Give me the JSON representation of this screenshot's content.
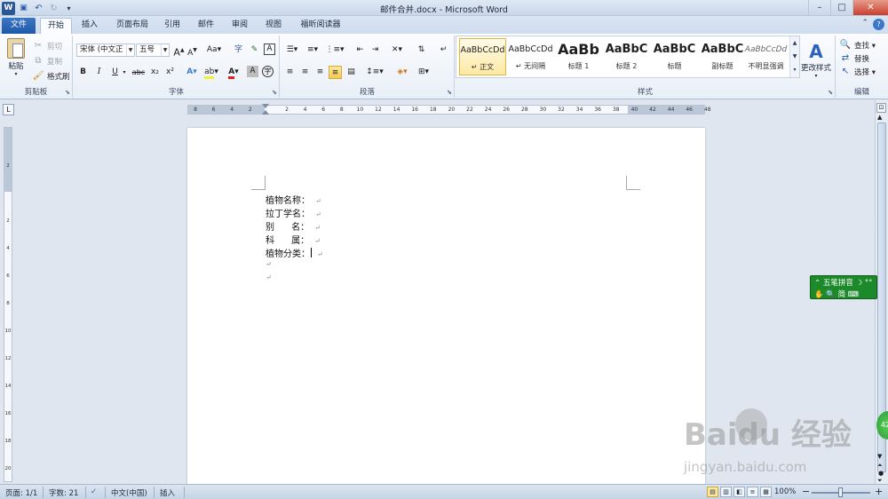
{
  "app": {
    "title": "邮件合并.docx - Microsoft Word",
    "window_buttons": {
      "minimize": "–",
      "maximize": "□",
      "close": "✕"
    },
    "help": "?"
  },
  "quick_access": [
    {
      "icon": "word-logo-icon",
      "glyph": "W"
    },
    {
      "icon": "save-icon",
      "glyph": "💾"
    },
    {
      "icon": "undo-icon",
      "glyph": "↶"
    },
    {
      "icon": "redo-icon",
      "glyph": "↻"
    },
    {
      "icon": "customize-icon",
      "glyph": "▾"
    }
  ],
  "tabs": [
    {
      "label": "文件",
      "name": "tab-file"
    },
    {
      "label": "开始",
      "name": "tab-home",
      "active": true
    },
    {
      "label": "插入",
      "name": "tab-insert"
    },
    {
      "label": "页面布局",
      "name": "tab-page-layout"
    },
    {
      "label": "引用",
      "name": "tab-references"
    },
    {
      "label": "邮件",
      "name": "tab-mailings"
    },
    {
      "label": "审阅",
      "name": "tab-review"
    },
    {
      "label": "视图",
      "name": "tab-view"
    },
    {
      "label": "福昕阅读器",
      "name": "tab-foxit"
    }
  ],
  "ribbon": {
    "clipboard": {
      "label": "剪贴板",
      "paste": "粘贴",
      "cut": "剪切",
      "copy": "复制",
      "format_painter": "格式刷"
    },
    "font": {
      "label": "字体",
      "font_name": "宋体 (中文正",
      "font_size": "五号",
      "grow": "A",
      "shrink": "A",
      "change_case": "Aa",
      "bold": "B",
      "italic": "I",
      "underline": "U",
      "strike": "abc",
      "subscript": "x₂",
      "superscript": "x²"
    },
    "paragraph": {
      "label": "段落"
    },
    "styles": {
      "label": "样式",
      "items": [
        {
          "preview": "AaBbCcDd",
          "name": "↵ 正文",
          "selected": true,
          "size": "9.5px",
          "weight": "normal"
        },
        {
          "preview": "AaBbCcDd",
          "name": "↵ 无间隔",
          "selected": false,
          "size": "9.5px",
          "weight": "normal"
        },
        {
          "preview": "AaBb",
          "name": "标题 1",
          "selected": false,
          "size": "16px",
          "weight": "bold"
        },
        {
          "preview": "AaBbC",
          "name": "标题 2",
          "selected": false,
          "size": "13px",
          "weight": "bold"
        },
        {
          "preview": "AaBbC",
          "name": "标题",
          "selected": false,
          "size": "13px",
          "weight": "bold"
        },
        {
          "preview": "AaBbC",
          "name": "副标题",
          "selected": false,
          "size": "13px",
          "weight": "bold"
        },
        {
          "preview": "AaBbCcDd",
          "name": "不明显强调",
          "selected": false,
          "size": "9.5px",
          "weight": "normal"
        }
      ],
      "change_styles": "更改样式"
    },
    "editing": {
      "label": "编辑",
      "find": "查找 ▾",
      "replace": "替换",
      "select": "选择 ▾"
    }
  },
  "ruler": {
    "ticks": [
      "8",
      "6",
      "4",
      "2",
      "",
      "2",
      "4",
      "6",
      "8",
      "10",
      "12",
      "14",
      "16",
      "18",
      "20",
      "22",
      "24",
      "26",
      "28",
      "30",
      "32",
      "34",
      "36",
      "38",
      "40",
      "42",
      "44",
      "46",
      "48"
    ],
    "vticks": [
      "2",
      "",
      "2",
      "4",
      "6",
      "8",
      "10",
      "12",
      "14",
      "16",
      "18",
      "20"
    ]
  },
  "document": {
    "lines": [
      "植物名称：",
      "拉丁学名：",
      "别      名：",
      "科      属：",
      "植物分类：",
      "",
      ""
    ],
    "pilcrow": "↵"
  },
  "ime": {
    "line1": "⌃ 五笔拼音  ☽ °°",
    "line2": "✋ 🔍 简 ⌨"
  },
  "green_badge": "42",
  "watermark": {
    "brand": "Baidu 经验",
    "url": "jingyan.baidu.com"
  },
  "status": {
    "page": "页面: 1/1",
    "words": "字数: 21",
    "language": "中文(中国)",
    "mode": "插入",
    "zoom": "100%",
    "zoom_minus": "−",
    "zoom_plus": "+"
  }
}
